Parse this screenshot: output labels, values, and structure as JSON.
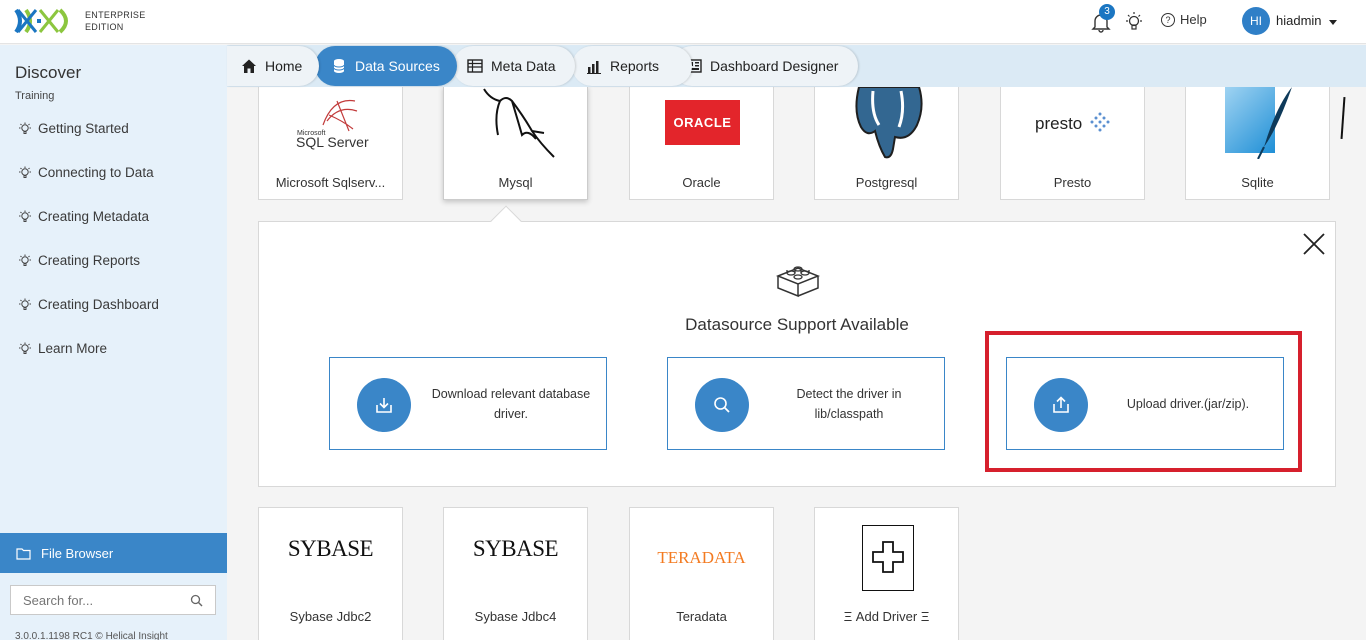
{
  "header": {
    "edition_line1": "ENTERPRISE",
    "edition_line2": "EDITION",
    "notification_count": "3",
    "help_label": "Help",
    "avatar_initials": "HI",
    "username": "hiadmin"
  },
  "sidebar": {
    "title": "Discover",
    "subtitle": "Training",
    "items": [
      {
        "label": "Getting Started"
      },
      {
        "label": "Connecting to Data"
      },
      {
        "label": "Creating Metadata"
      },
      {
        "label": "Creating Reports"
      },
      {
        "label": "Creating Dashboard"
      },
      {
        "label": "Learn More"
      }
    ],
    "file_browser": "File Browser",
    "search_placeholder": "Search for...",
    "version": "3.0.0.1.1198 RC1     © Helical Insight"
  },
  "nav": {
    "tabs": [
      {
        "label": "Home",
        "icon": "home-icon"
      },
      {
        "label": "Data Sources",
        "icon": "database-icon",
        "active": true
      },
      {
        "label": "Meta Data",
        "icon": "table-icon"
      },
      {
        "label": "Reports",
        "icon": "bar-chart-icon"
      },
      {
        "label": "Dashboard Designer",
        "icon": "dashboard-icon"
      }
    ]
  },
  "datasources": {
    "row1": [
      {
        "label": "Microsoft Sqlserv...",
        "logo_small": "Microsoft",
        "logo": "SQL Server"
      },
      {
        "label": "Mysql"
      },
      {
        "label": "Oracle",
        "logo": "ORACLE"
      },
      {
        "label": "Postgresql"
      },
      {
        "label": "Presto",
        "logo": "presto"
      },
      {
        "label": "Sqlite"
      }
    ],
    "row2": [
      {
        "label": "Sybase Jdbc2",
        "logo": "SYBASE"
      },
      {
        "label": "Sybase Jdbc4",
        "logo": "SYBASE"
      },
      {
        "label": "Teradata",
        "logo": "TERADATA"
      },
      {
        "label": "Ξ Add Driver Ξ"
      }
    ]
  },
  "panel": {
    "title": "Datasource Support Available",
    "options": [
      {
        "label": "Download relevant database driver."
      },
      {
        "label": "Detect the driver in lib/classpath"
      },
      {
        "label": "Upload driver.(jar/zip)."
      }
    ]
  },
  "colors": {
    "accent": "#3a86c8",
    "highlight": "#d6202d",
    "sidebar_bg": "#e6f1fa",
    "nav_bg": "#dbeaf5"
  }
}
